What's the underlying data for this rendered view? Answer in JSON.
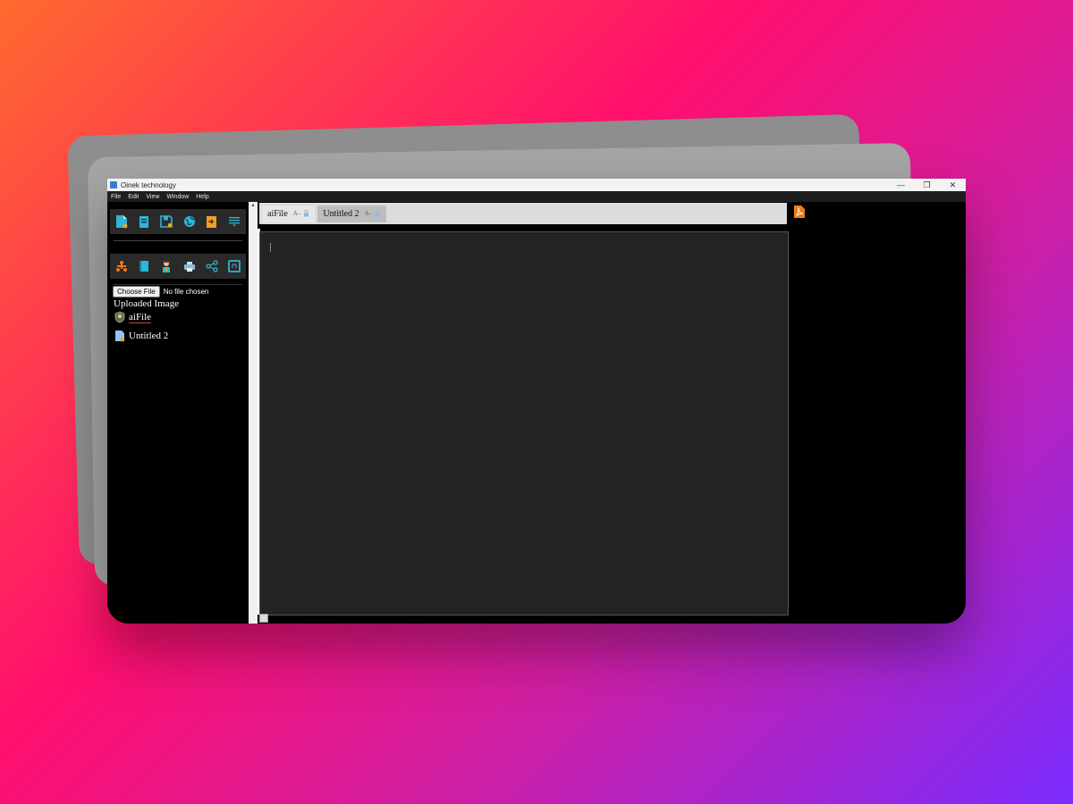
{
  "window": {
    "title": "Oinek technology",
    "controls": [
      "—",
      "❐",
      "✕"
    ]
  },
  "menu": [
    "File",
    "Edit",
    "View",
    "Window",
    "Help"
  ],
  "toolbar1": [
    {
      "icon": "new-file-icon"
    },
    {
      "icon": "book-icon"
    },
    {
      "icon": "save-icon"
    },
    {
      "icon": "globe-icon"
    },
    {
      "icon": "import-icon"
    },
    {
      "icon": "menu-lines-icon"
    }
  ],
  "toolbar2": [
    {
      "icon": "network-icon"
    },
    {
      "icon": "notebook-icon"
    },
    {
      "icon": "robot-user-icon"
    },
    {
      "icon": "printer-icon"
    },
    {
      "icon": "share-icon"
    },
    {
      "icon": "terminal-icon"
    }
  ],
  "file_input": {
    "button_label": "Choose File",
    "status": "No file chosen"
  },
  "uploaded_image_alt": "Uploaded Image",
  "files": [
    {
      "name": "aiFile",
      "icon": "ai-shield-icon"
    },
    {
      "name": "Untitled 2",
      "icon": "document-icon"
    }
  ],
  "tabs": [
    {
      "label": "aiFile",
      "font_toggle": "A–",
      "active": false
    },
    {
      "label": "Untitled 2",
      "font_toggle": "A–",
      "active": true
    }
  ],
  "colors": {
    "accent_cyan": "#2fb5d6",
    "accent_orange": "#f07a18",
    "editor_bg": "#232323"
  }
}
